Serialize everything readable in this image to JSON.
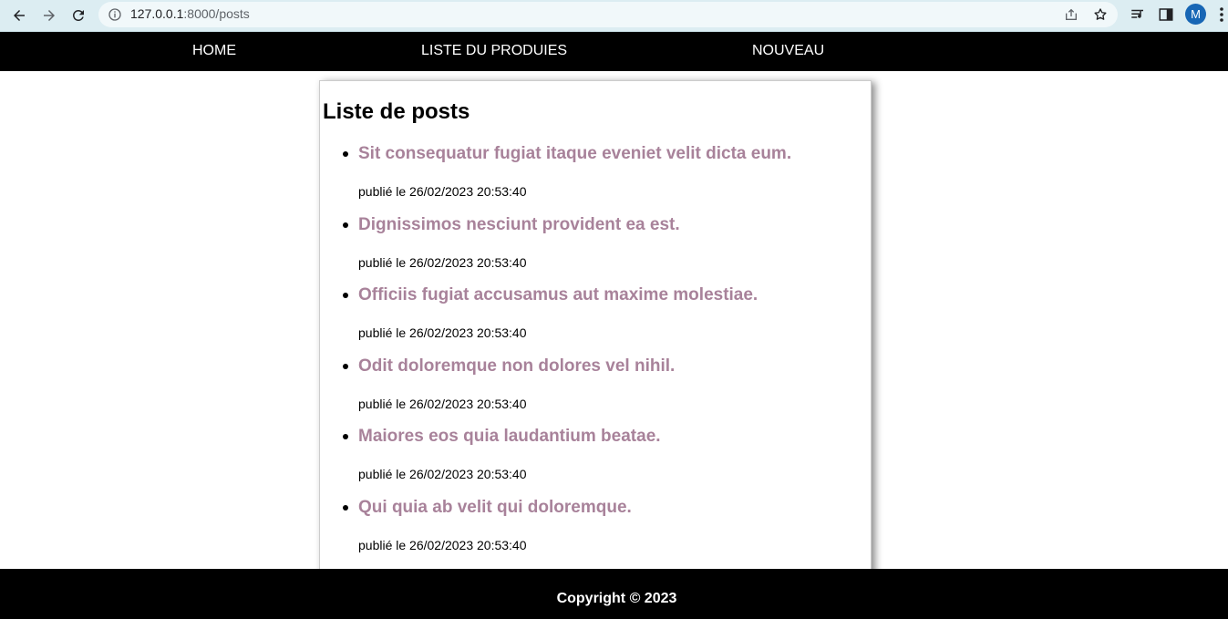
{
  "browser": {
    "url_host": "127.0.0.1",
    "url_rest": ":8000/posts",
    "profile_initial": "M"
  },
  "nav": {
    "home": "HOME",
    "list": "LISTE DU PRODUIES",
    "new": "NOUVEAU"
  },
  "page": {
    "heading": "Liste de posts"
  },
  "posts": [
    {
      "title": "Sit consequatur fugiat itaque eveniet velit dicta eum.",
      "published": "publié le 26/02/2023 20:53:40"
    },
    {
      "title": "Dignissimos nesciunt provident ea est.",
      "published": "publié le 26/02/2023 20:53:40"
    },
    {
      "title": "Officiis fugiat accusamus aut maxime molestiae.",
      "published": "publié le 26/02/2023 20:53:40"
    },
    {
      "title": "Odit doloremque non dolores vel nihil.",
      "published": "publié le 26/02/2023 20:53:40"
    },
    {
      "title": "Maiores eos quia laudantium beatae.",
      "published": "publié le 26/02/2023 20:53:40"
    },
    {
      "title": "Qui quia ab velit qui doloremque.",
      "published": "publié le 26/02/2023 20:53:40"
    }
  ],
  "footer": {
    "copyright": "Copyright © 2023"
  },
  "colors": {
    "post_title": "#a8829a",
    "nav_bg": "#000000",
    "chrome_bg": "#dcedf2",
    "avatar": "#1766b5"
  },
  "icons": {
    "back": "back-arrow-icon",
    "forward": "forward-arrow-icon",
    "reload": "reload-icon",
    "info": "info-icon",
    "share": "share-icon",
    "bookmark": "star-icon",
    "media": "media-queue-icon",
    "sidepanel": "side-panel-icon",
    "menu": "more-vert-icon"
  }
}
